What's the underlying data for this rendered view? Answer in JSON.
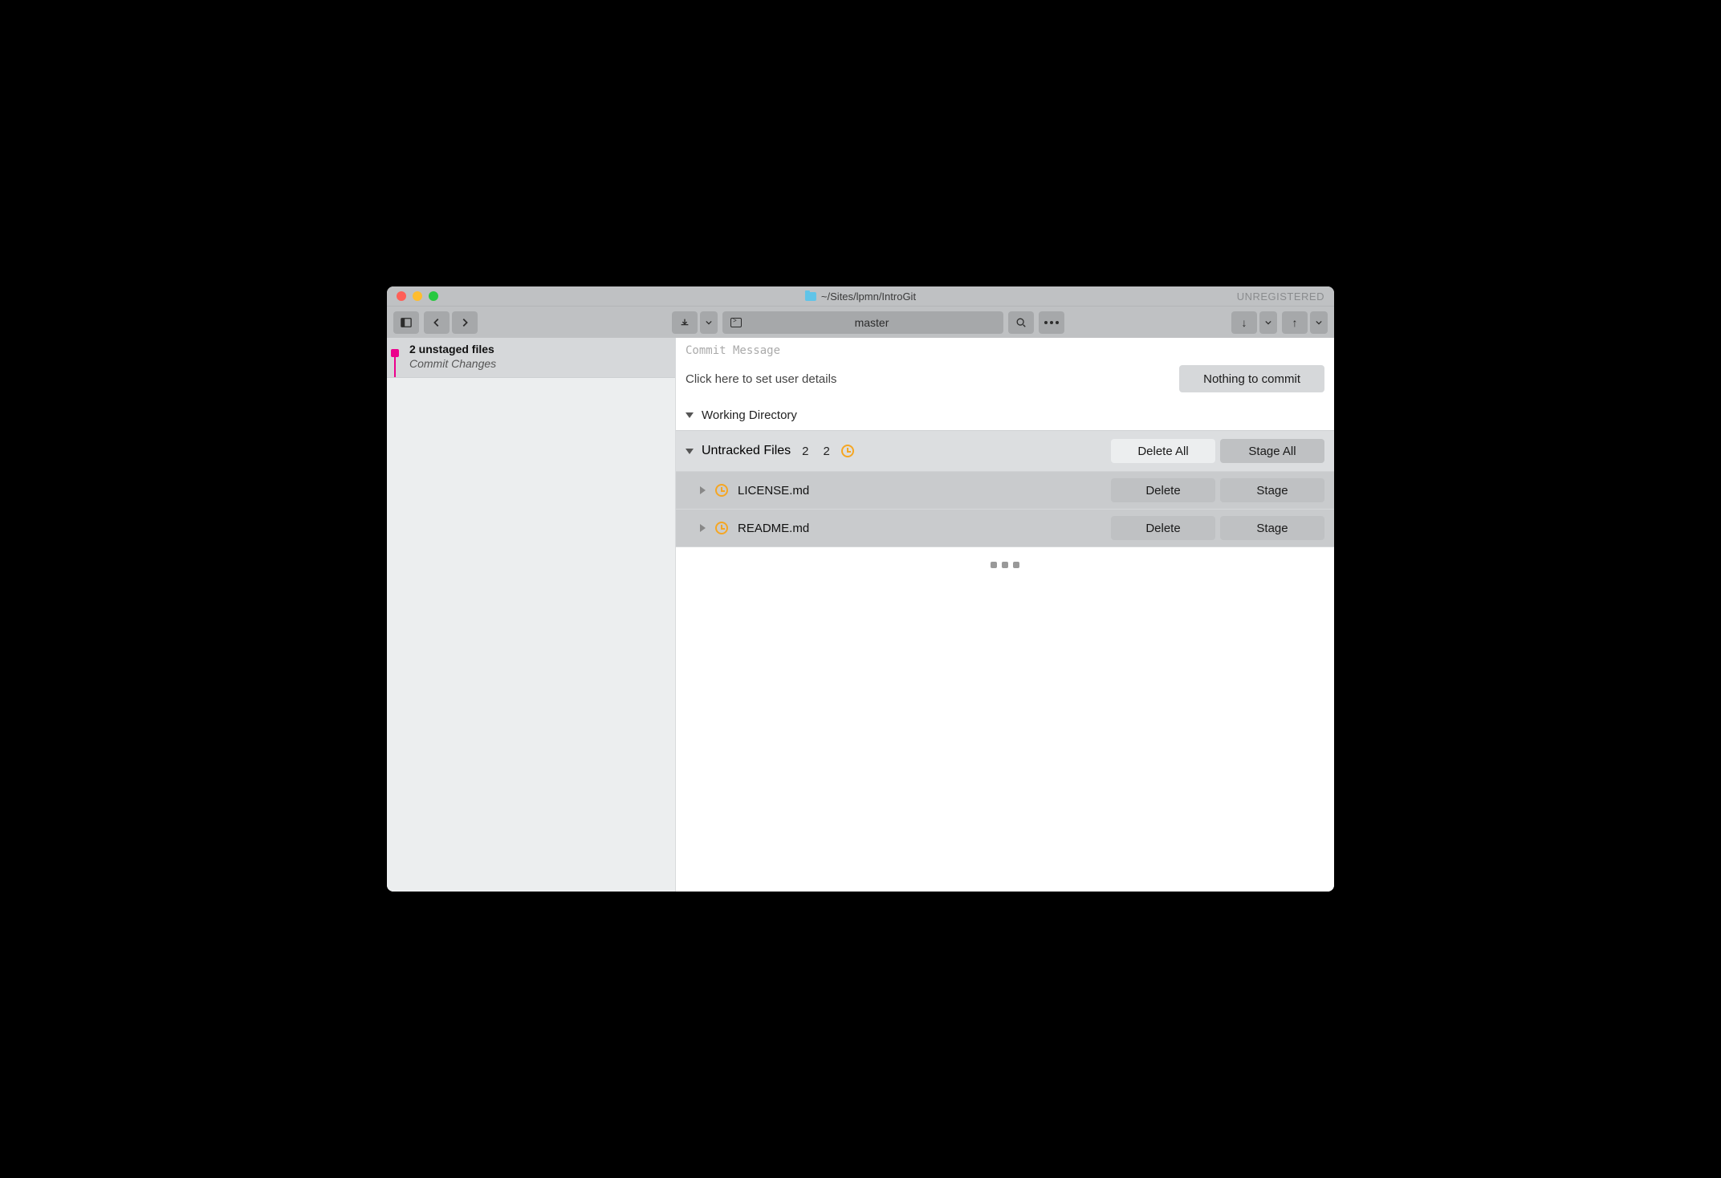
{
  "titlebar": {
    "path": "~/Sites/lpmn/IntroGit",
    "unregistered": "UNREGISTERED"
  },
  "toolbar": {
    "branch": "master"
  },
  "sidebar": {
    "commit": {
      "title": "2 unstaged files",
      "subtitle": "Commit Changes"
    }
  },
  "main": {
    "commit_placeholder": "Commit Message",
    "user_hint": "Click here to set user details",
    "commit_button": "Nothing to commit",
    "working_dir": "Working Directory",
    "untracked": {
      "label": "Untracked Files",
      "count1": "2",
      "count2": "2",
      "delete_all": "Delete All",
      "stage_all": "Stage All"
    },
    "files": [
      {
        "name": "LICENSE.md",
        "delete": "Delete",
        "stage": "Stage"
      },
      {
        "name": "README.md",
        "delete": "Delete",
        "stage": "Stage"
      }
    ]
  }
}
